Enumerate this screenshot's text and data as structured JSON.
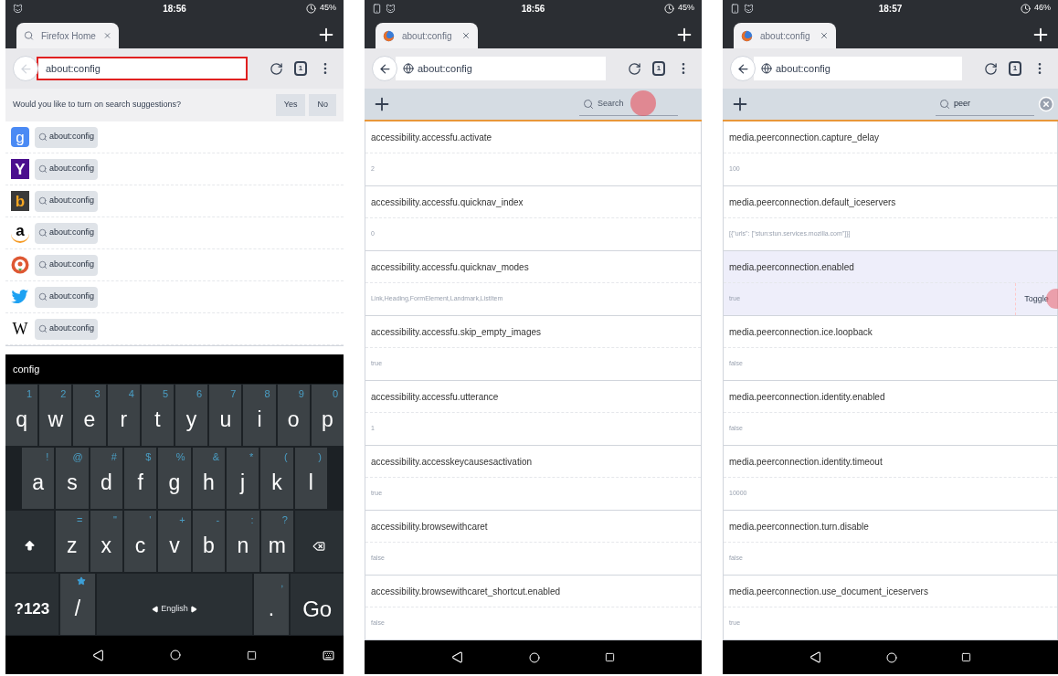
{
  "panels": [
    {
      "kind": "suggestions",
      "status_bar": {
        "time": "18:56",
        "battery": "45%"
      },
      "tab": {
        "title": "Firefox Home"
      },
      "url_bar": {
        "value": "about:config",
        "focused": true,
        "back_enabled": false,
        "site_icon": false
      },
      "tab_count": "1",
      "prompt": {
        "text": "Would you like to turn on search suggestions?",
        "buttons": [
          "Yes",
          "No"
        ]
      },
      "engines": [
        {
          "kind": "google",
          "logo_text": "g",
          "query": "about:config"
        },
        {
          "kind": "yahoo",
          "logo_text": "Y",
          "query": "about:config"
        },
        {
          "kind": "bing",
          "logo_text": "b",
          "query": "about:config"
        },
        {
          "kind": "amazon",
          "logo_text": "a",
          "query": "about:config"
        },
        {
          "kind": "duck",
          "query": "about:config"
        },
        {
          "kind": "bird",
          "query": "about:config"
        },
        {
          "kind": "wiki",
          "logo_text": "W",
          "query": "about:config"
        }
      ],
      "keyboard": {
        "suggestion": "config",
        "key_rows": [
          {
            "keys": [
              {
                "kind": "char",
                "label": "q",
                "hint": "1"
              },
              {
                "kind": "char",
                "label": "w",
                "hint": "2"
              },
              {
                "kind": "char",
                "label": "e",
                "hint": "3"
              },
              {
                "kind": "char",
                "label": "r",
                "hint": "4"
              },
              {
                "kind": "char",
                "label": "t",
                "hint": "5"
              },
              {
                "kind": "char",
                "label": "y",
                "hint": "6"
              },
              {
                "kind": "char",
                "label": "u",
                "hint": "7"
              },
              {
                "kind": "char",
                "label": "i",
                "hint": "8"
              },
              {
                "kind": "char",
                "label": "o",
                "hint": "9"
              },
              {
                "kind": "char",
                "label": "p",
                "hint": "0"
              }
            ]
          },
          {
            "keys": [
              {
                "kind": "char",
                "label": "a",
                "hint": "!"
              },
              {
                "kind": "char",
                "label": "s",
                "hint": "@"
              },
              {
                "kind": "char",
                "label": "d",
                "hint": "#"
              },
              {
                "kind": "char",
                "label": "f",
                "hint": "$"
              },
              {
                "kind": "char",
                "label": "g",
                "hint": "%"
              },
              {
                "kind": "char",
                "label": "h",
                "hint": "&"
              },
              {
                "kind": "char",
                "label": "j",
                "hint": "*"
              },
              {
                "kind": "char",
                "label": "k",
                "hint": "("
              },
              {
                "kind": "char",
                "label": "l",
                "hint": ")"
              }
            ]
          },
          {
            "keys": [
              {
                "kind": "shift"
              },
              {
                "kind": "char",
                "label": "z",
                "hint": "="
              },
              {
                "kind": "char",
                "label": "x",
                "hint": "\""
              },
              {
                "kind": "char",
                "label": "c",
                "hint": "'"
              },
              {
                "kind": "char",
                "label": "v",
                "hint": "+"
              },
              {
                "kind": "char",
                "label": "b",
                "hint": "-"
              },
              {
                "kind": "char",
                "label": "n",
                "hint": ":"
              },
              {
                "kind": "char",
                "label": "m",
                "hint": "?"
              },
              {
                "kind": "backspace"
              }
            ]
          },
          {
            "keys": [
              {
                "kind": "mode",
                "label": "?123"
              },
              {
                "kind": "char",
                "label": "/",
                "starred": true
              },
              {
                "kind": "space",
                "label": "English"
              },
              {
                "kind": "char",
                "label": ".",
                "hint": ","
              },
              {
                "kind": "action",
                "label": "Go"
              }
            ]
          }
        ]
      },
      "nav_bar": {
        "keyboard_switch": true
      }
    },
    {
      "kind": "config",
      "status_bar": {
        "time": "18:56",
        "battery": "45%"
      },
      "tab": {
        "title": "about:config"
      },
      "url_bar": {
        "value": "about:config",
        "focused": false,
        "back_enabled": true,
        "site_icon": true
      },
      "tab_count": "1",
      "search": {
        "placeholder": "Search",
        "touch": true,
        "clearable": false
      },
      "prefs": [
        {
          "name": "accessibility.accessfu.activate",
          "value": "2",
          "selected": false
        },
        {
          "name": "accessibility.accessfu.quicknav_index",
          "value": "0",
          "selected": false
        },
        {
          "name": "accessibility.accessfu.quicknav_modes",
          "value": "Link,Heading,FormElement,Landmark,ListItem",
          "selected": false
        },
        {
          "name": "accessibility.accessfu.skip_empty_images",
          "value": "true",
          "selected": false
        },
        {
          "name": "accessibility.accessfu.utterance",
          "value": "1",
          "selected": false
        },
        {
          "name": "accessibility.accesskeycausesactivation",
          "value": "true",
          "selected": false
        },
        {
          "name": "accessibility.browsewithcaret",
          "value": "false",
          "selected": false
        },
        {
          "name": "accessibility.browsewithcaret_shortcut.enabled",
          "value": "false",
          "selected": false
        }
      ],
      "nav_bar": {
        "keyboard_switch": false
      }
    },
    {
      "kind": "config",
      "status_bar": {
        "time": "18:57",
        "battery": "46%"
      },
      "tab": {
        "title": "about:config"
      },
      "url_bar": {
        "value": "about:config",
        "focused": false,
        "back_enabled": true,
        "site_icon": true
      },
      "tab_count": "1",
      "search": {
        "value": "peer",
        "touch": false,
        "clearable": true
      },
      "prefs": [
        {
          "name": "media.peerconnection.capture_delay",
          "value": "100",
          "selected": false
        },
        {
          "name": "media.peerconnection.default_iceservers",
          "value": "[{\"urls\": [\"stun:stun.services.mozilla.com\"]}]",
          "selected": false
        },
        {
          "name": "media.peerconnection.enabled",
          "value": "true",
          "selected": true,
          "action": "Toggle",
          "touch": true
        },
        {
          "name": "media.peerconnection.ice.loopback",
          "value": "false",
          "selected": false
        },
        {
          "name": "media.peerconnection.identity.enabled",
          "value": "false",
          "selected": false
        },
        {
          "name": "media.peerconnection.identity.timeout",
          "value": "10000",
          "selected": false
        },
        {
          "name": "media.peerconnection.turn.disable",
          "value": "false",
          "selected": false
        },
        {
          "name": "media.peerconnection.use_document_iceservers",
          "value": "true",
          "selected": false
        }
      ],
      "nav_bar": {
        "keyboard_switch": false
      }
    }
  ]
}
